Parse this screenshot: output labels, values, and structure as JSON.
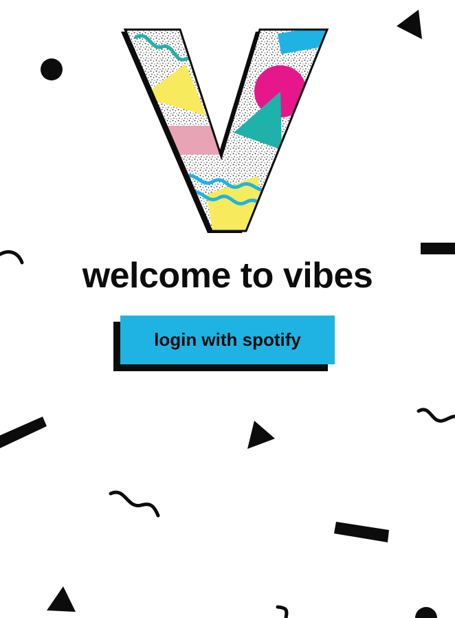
{
  "app": {
    "logo_letter": "V"
  },
  "welcome": {
    "title": "welcome to vibes"
  },
  "login": {
    "button_label": "login with spotify"
  },
  "colors": {
    "accent_blue": "#1fb3e4",
    "ink": "#0c0c0c",
    "yellow": "#f7ea5c",
    "pink": "#e8a3b5",
    "magenta": "#e5178a",
    "teal": "#1fb2aa",
    "background": "#ffffff"
  },
  "decorations": {
    "shape_icons": [
      "circle-icon",
      "triangle-icon",
      "bar-icon",
      "squiggle-icon"
    ]
  }
}
